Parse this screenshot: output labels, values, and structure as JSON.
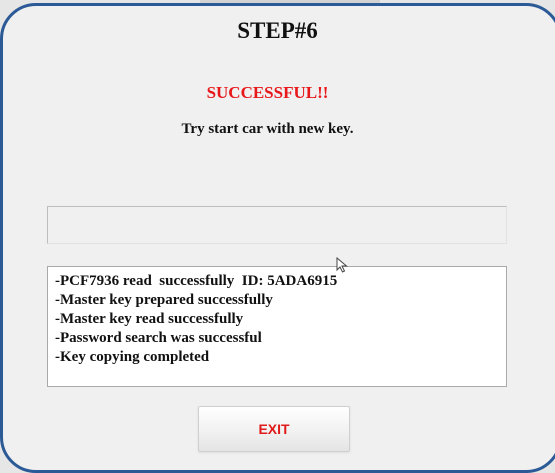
{
  "dialog": {
    "title": "STEP#6",
    "status": "SUCCESSFUL!!",
    "instruction": "Try start car with new key.",
    "status_field_value": "",
    "log": [
      "-PCF7936 read  successfully  ID: 5ADA6915",
      "-Master key prepared successfully",
      "-Master key read successfully",
      "-Password search was successful",
      "-Key copying completed"
    ],
    "exit_label": "EXIT"
  },
  "colors": {
    "border": "#2b5a96",
    "status": "#e8171a",
    "exit_text": "#e01a1a",
    "background": "#f0f0f0"
  },
  "icons": {
    "cursor": "mouse-pointer-icon"
  }
}
